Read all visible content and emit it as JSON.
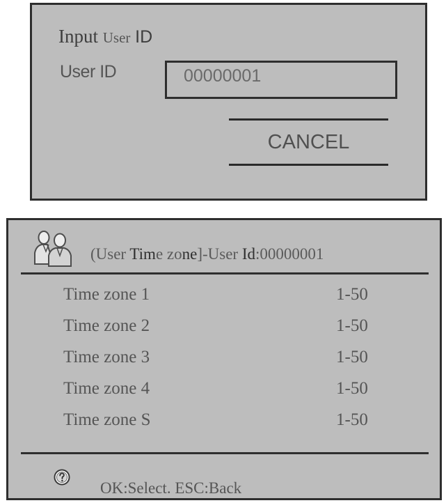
{
  "input_dialog": {
    "title_word1": "Input",
    "title_word2": "User",
    "title_word3": "ID",
    "field_label": "User ID",
    "field_value": "00000001",
    "cancel_label": "CANCEL"
  },
  "time_zone_window": {
    "header": {
      "icon": "users-icon",
      "title_parts": [
        "(User ",
        "Tim",
        "e zo",
        "ne",
        "]-User ",
        "Id",
        ":00000001"
      ]
    },
    "rows": [
      {
        "name": "Time zone 1",
        "range": "1-50"
      },
      {
        "name": "Time zone 2",
        "range": "1-50"
      },
      {
        "name": "Time zone 3",
        "range": "1-50"
      },
      {
        "name": "Time zone 4",
        "range": "1-50"
      },
      {
        "name": "Time zone S",
        "range": "1-50"
      }
    ],
    "footer": {
      "icon": "help-icon",
      "hint_parts": [
        "OK:",
        "Select. ",
        "ESC:Back"
      ]
    }
  },
  "colors": {
    "panel_bg": "#bdbdbd",
    "border": "#2e2e2e",
    "text": "#555555"
  }
}
